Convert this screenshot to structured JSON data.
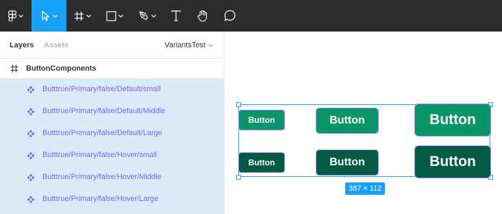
{
  "toolbar": {
    "tools": [
      {
        "name": "main-menu",
        "icon": "figma-logo-icon"
      },
      {
        "name": "move-tool",
        "icon": "cursor-arrow-icon",
        "active": true
      },
      {
        "name": "frame-tool",
        "icon": "frame-hash-icon"
      },
      {
        "name": "shape-tool",
        "icon": "rectangle-icon"
      },
      {
        "name": "pen-tool",
        "icon": "pen-icon"
      },
      {
        "name": "text-tool",
        "icon": "text-t-icon"
      },
      {
        "name": "hand-tool",
        "icon": "hand-icon"
      },
      {
        "name": "comment-tool",
        "icon": "speech-bubble-icon"
      }
    ],
    "accent_color": "#18a0fb",
    "background_color": "#2c2c2c"
  },
  "panel": {
    "tabs": {
      "layers": "Layers",
      "assets": "Assets"
    },
    "page_name": "VariantsTest",
    "frame": {
      "label": "ButtonComponents",
      "icon": "hash-icon"
    },
    "layers": [
      {
        "label": "Butttrue/Primary/false/Default/small",
        "icon": "component-icon"
      },
      {
        "label": "Butttrue/Primary/false/Default/Middle",
        "icon": "component-icon"
      },
      {
        "label": "Butttrue/Primary/false/Default/Large",
        "icon": "component-icon"
      },
      {
        "label": "Butttrue/Primary/false/Hover/small",
        "icon": "component-icon"
      },
      {
        "label": "Butttrue/Primary/false/Hover/Middle",
        "icon": "component-icon"
      },
      {
        "label": "Butttrue/Primary/false/Hover/Large",
        "icon": "component-icon"
      }
    ],
    "selection_color": "#daebf7",
    "component_color": "#7b61ff"
  },
  "canvas": {
    "buttons": {
      "default_small": "Button",
      "default_middle": "Button",
      "default_large": "Button",
      "hover_small": "Button",
      "hover_middle": "Button",
      "hover_large": "Button"
    },
    "primary_color": "#0c9569",
    "hover_color": "#045a42",
    "dimensions_label": "387 × 112"
  }
}
